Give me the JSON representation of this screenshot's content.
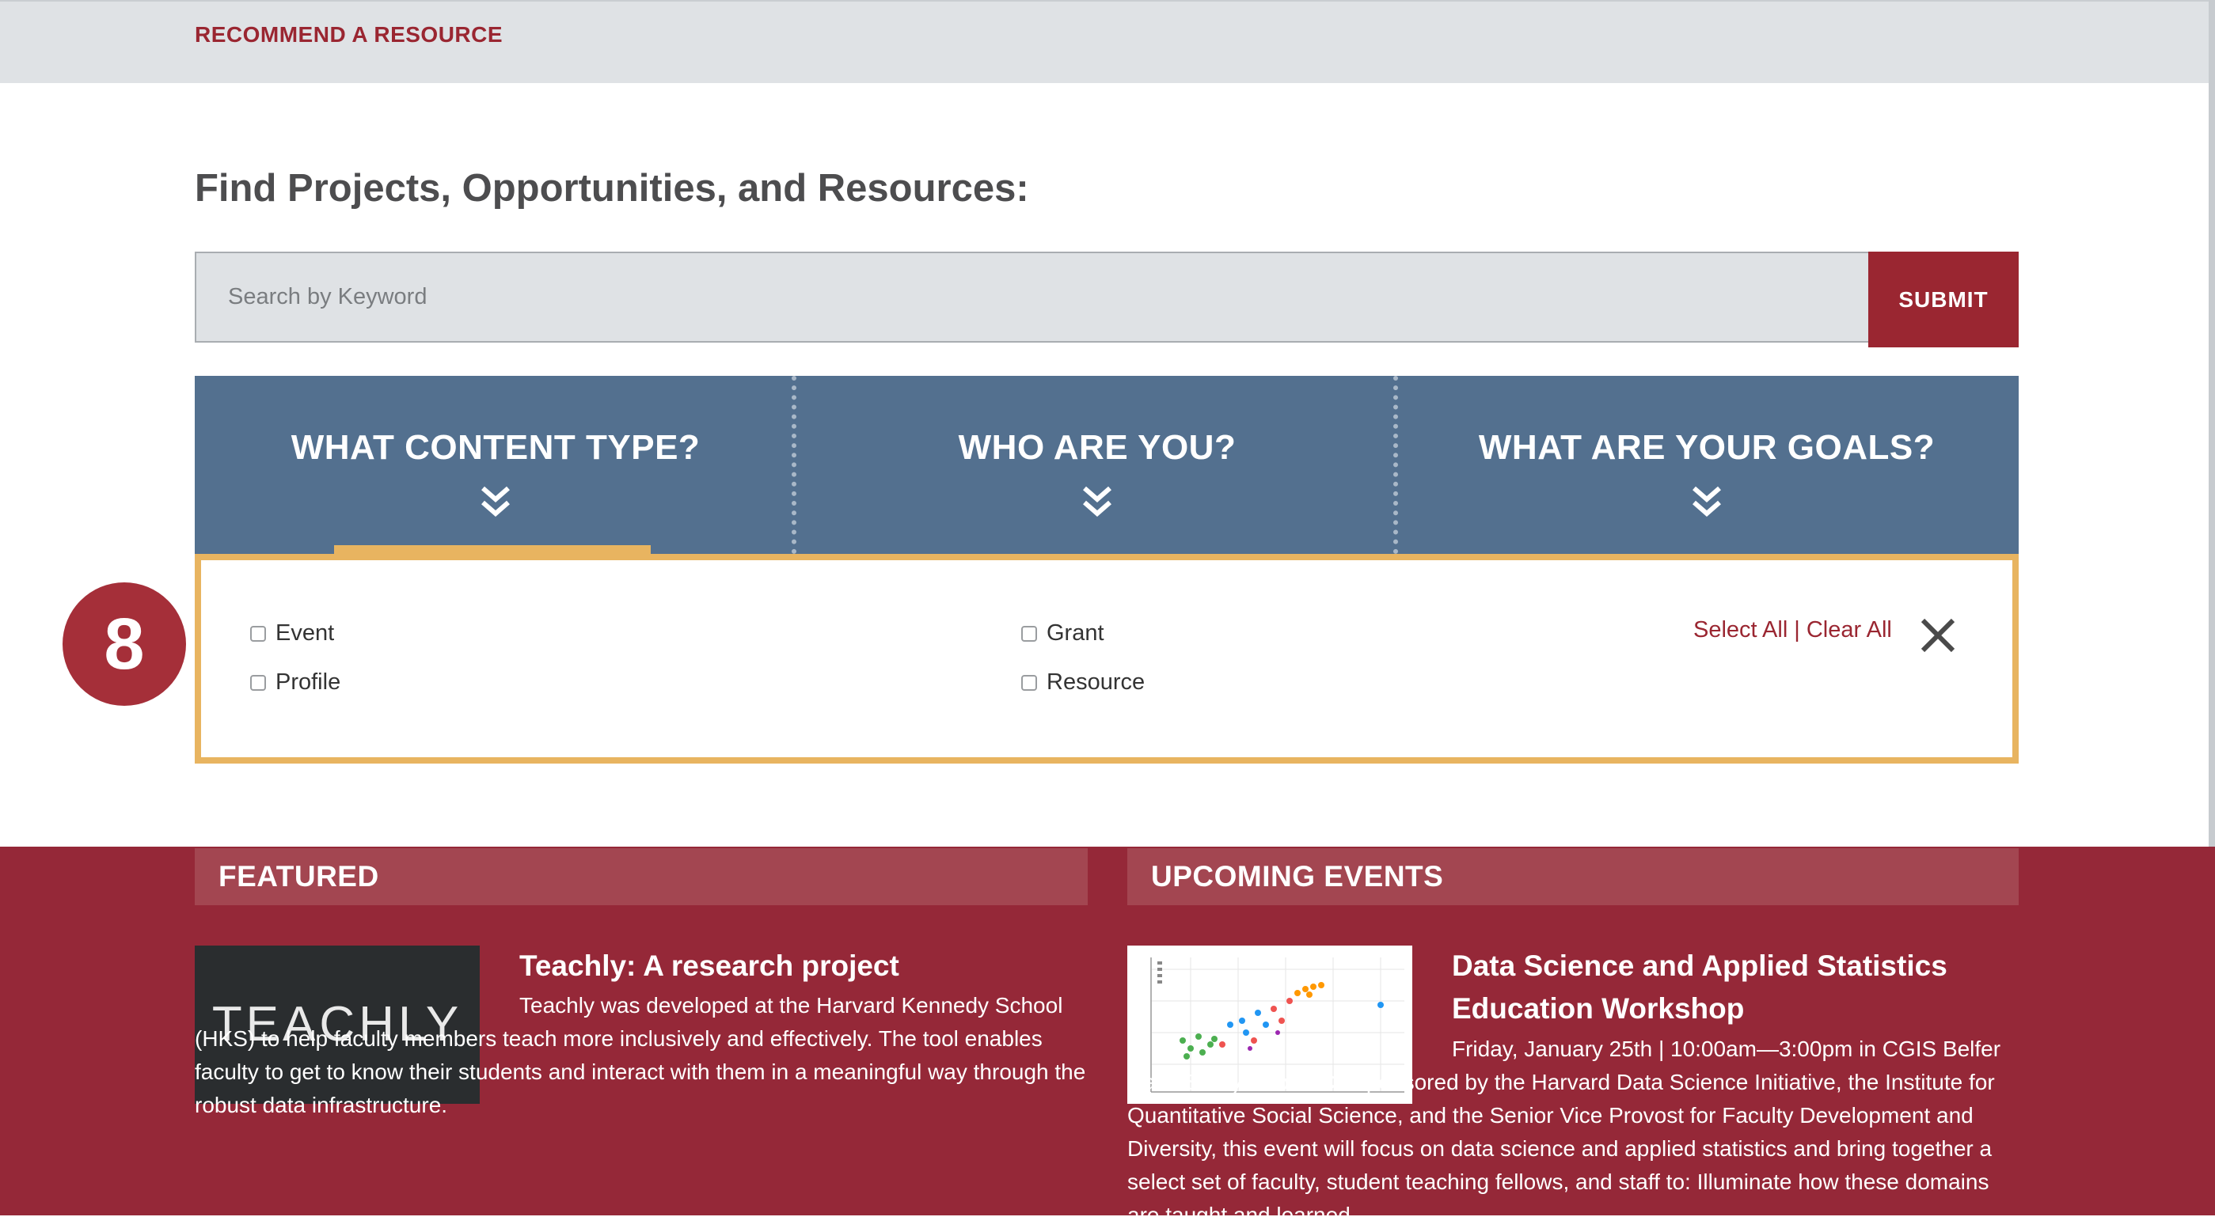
{
  "top_bar": {
    "recommend_label": "RECOMMEND A RESOURCE"
  },
  "finder": {
    "heading": "Find Projects, Opportunities, and Resources:",
    "search_placeholder": "Search by Keyword",
    "submit_label": "SUBMIT"
  },
  "filters": {
    "tabs": [
      {
        "label": "WHAT CONTENT TYPE?",
        "icon": "double-chevron-down-icon",
        "active": true
      },
      {
        "label": "WHO ARE YOU?",
        "icon": "double-chevron-down-icon",
        "active": false
      },
      {
        "label": "WHAT ARE YOUR GOALS?",
        "icon": "double-chevron-down-icon",
        "active": false
      }
    ],
    "step_badge": "8",
    "options": [
      {
        "label": "Event",
        "checked": false
      },
      {
        "label": "Profile",
        "checked": false
      },
      {
        "label": "Grant",
        "checked": false
      },
      {
        "label": "Resource",
        "checked": false
      }
    ],
    "select_all_label": "Select All",
    "separator": "|",
    "clear_all_label": "Clear All",
    "close_icon": "close-icon"
  },
  "featured": {
    "header": "FEATURED",
    "image_text": "TEACHLY",
    "title": "Teachly: A research project",
    "body": "Teachly was developed at the Harvard Kennedy School (HKS) to help faculty members teach more inclusively and effectively. The tool enables faculty to get to know their students and interact with them in a meaningful way through the robust data infrastructure."
  },
  "upcoming_events": {
    "header": "UPCOMING EVENTS",
    "title": "Data Science and Applied Statistics Education Workshop",
    "body": "Friday, January 25th | 10:00am—3:00pm in CGIS Belfer Case Study Room. Co-sponsored by the Harvard Data Science Initiative, the Institute for Quantitative Social Science, and the Senior Vice Provost for Faculty Development and Diversity, this event will focus on data science and applied statistics and bring together a select set of faculty, student teaching fellows, and staff to: Illuminate how these domains are taught and learned"
  },
  "colors": {
    "crimson": "#952838",
    "header_band": "#a34651",
    "tab_blue": "#53708f",
    "gold_accent": "#e8b460",
    "badge_red": "#a52f39"
  }
}
